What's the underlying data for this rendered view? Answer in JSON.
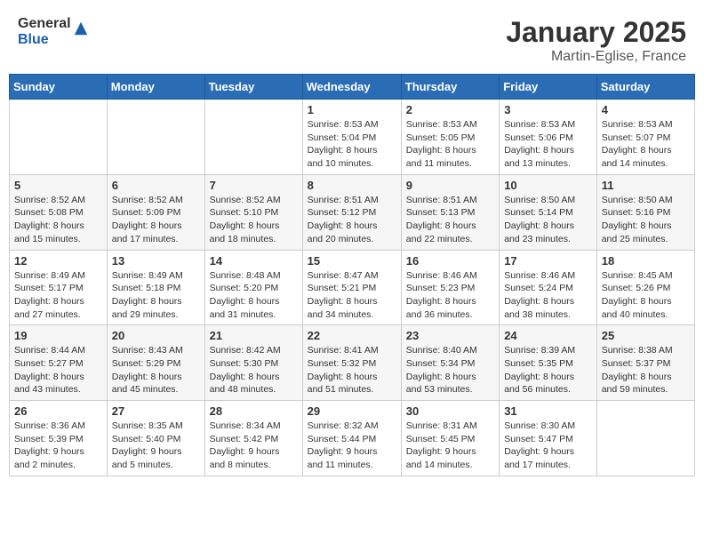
{
  "header": {
    "logo_general": "General",
    "logo_blue": "Blue",
    "month": "January 2025",
    "location": "Martin-Eglise, France"
  },
  "days_of_week": [
    "Sunday",
    "Monday",
    "Tuesday",
    "Wednesday",
    "Thursday",
    "Friday",
    "Saturday"
  ],
  "weeks": [
    [
      {
        "num": "",
        "info": ""
      },
      {
        "num": "",
        "info": ""
      },
      {
        "num": "",
        "info": ""
      },
      {
        "num": "1",
        "info": "Sunrise: 8:53 AM\nSunset: 5:04 PM\nDaylight: 8 hours\nand 10 minutes."
      },
      {
        "num": "2",
        "info": "Sunrise: 8:53 AM\nSunset: 5:05 PM\nDaylight: 8 hours\nand 11 minutes."
      },
      {
        "num": "3",
        "info": "Sunrise: 8:53 AM\nSunset: 5:06 PM\nDaylight: 8 hours\nand 13 minutes."
      },
      {
        "num": "4",
        "info": "Sunrise: 8:53 AM\nSunset: 5:07 PM\nDaylight: 8 hours\nand 14 minutes."
      }
    ],
    [
      {
        "num": "5",
        "info": "Sunrise: 8:52 AM\nSunset: 5:08 PM\nDaylight: 8 hours\nand 15 minutes."
      },
      {
        "num": "6",
        "info": "Sunrise: 8:52 AM\nSunset: 5:09 PM\nDaylight: 8 hours\nand 17 minutes."
      },
      {
        "num": "7",
        "info": "Sunrise: 8:52 AM\nSunset: 5:10 PM\nDaylight: 8 hours\nand 18 minutes."
      },
      {
        "num": "8",
        "info": "Sunrise: 8:51 AM\nSunset: 5:12 PM\nDaylight: 8 hours\nand 20 minutes."
      },
      {
        "num": "9",
        "info": "Sunrise: 8:51 AM\nSunset: 5:13 PM\nDaylight: 8 hours\nand 22 minutes."
      },
      {
        "num": "10",
        "info": "Sunrise: 8:50 AM\nSunset: 5:14 PM\nDaylight: 8 hours\nand 23 minutes."
      },
      {
        "num": "11",
        "info": "Sunrise: 8:50 AM\nSunset: 5:16 PM\nDaylight: 8 hours\nand 25 minutes."
      }
    ],
    [
      {
        "num": "12",
        "info": "Sunrise: 8:49 AM\nSunset: 5:17 PM\nDaylight: 8 hours\nand 27 minutes."
      },
      {
        "num": "13",
        "info": "Sunrise: 8:49 AM\nSunset: 5:18 PM\nDaylight: 8 hours\nand 29 minutes."
      },
      {
        "num": "14",
        "info": "Sunrise: 8:48 AM\nSunset: 5:20 PM\nDaylight: 8 hours\nand 31 minutes."
      },
      {
        "num": "15",
        "info": "Sunrise: 8:47 AM\nSunset: 5:21 PM\nDaylight: 8 hours\nand 34 minutes."
      },
      {
        "num": "16",
        "info": "Sunrise: 8:46 AM\nSunset: 5:23 PM\nDaylight: 8 hours\nand 36 minutes."
      },
      {
        "num": "17",
        "info": "Sunrise: 8:46 AM\nSunset: 5:24 PM\nDaylight: 8 hours\nand 38 minutes."
      },
      {
        "num": "18",
        "info": "Sunrise: 8:45 AM\nSunset: 5:26 PM\nDaylight: 8 hours\nand 40 minutes."
      }
    ],
    [
      {
        "num": "19",
        "info": "Sunrise: 8:44 AM\nSunset: 5:27 PM\nDaylight: 8 hours\nand 43 minutes."
      },
      {
        "num": "20",
        "info": "Sunrise: 8:43 AM\nSunset: 5:29 PM\nDaylight: 8 hours\nand 45 minutes."
      },
      {
        "num": "21",
        "info": "Sunrise: 8:42 AM\nSunset: 5:30 PM\nDaylight: 8 hours\nand 48 minutes."
      },
      {
        "num": "22",
        "info": "Sunrise: 8:41 AM\nSunset: 5:32 PM\nDaylight: 8 hours\nand 51 minutes."
      },
      {
        "num": "23",
        "info": "Sunrise: 8:40 AM\nSunset: 5:34 PM\nDaylight: 8 hours\nand 53 minutes."
      },
      {
        "num": "24",
        "info": "Sunrise: 8:39 AM\nSunset: 5:35 PM\nDaylight: 8 hours\nand 56 minutes."
      },
      {
        "num": "25",
        "info": "Sunrise: 8:38 AM\nSunset: 5:37 PM\nDaylight: 8 hours\nand 59 minutes."
      }
    ],
    [
      {
        "num": "26",
        "info": "Sunrise: 8:36 AM\nSunset: 5:39 PM\nDaylight: 9 hours\nand 2 minutes."
      },
      {
        "num": "27",
        "info": "Sunrise: 8:35 AM\nSunset: 5:40 PM\nDaylight: 9 hours\nand 5 minutes."
      },
      {
        "num": "28",
        "info": "Sunrise: 8:34 AM\nSunset: 5:42 PM\nDaylight: 9 hours\nand 8 minutes."
      },
      {
        "num": "29",
        "info": "Sunrise: 8:32 AM\nSunset: 5:44 PM\nDaylight: 9 hours\nand 11 minutes."
      },
      {
        "num": "30",
        "info": "Sunrise: 8:31 AM\nSunset: 5:45 PM\nDaylight: 9 hours\nand 14 minutes."
      },
      {
        "num": "31",
        "info": "Sunrise: 8:30 AM\nSunset: 5:47 PM\nDaylight: 9 hours\nand 17 minutes."
      },
      {
        "num": "",
        "info": ""
      }
    ]
  ]
}
